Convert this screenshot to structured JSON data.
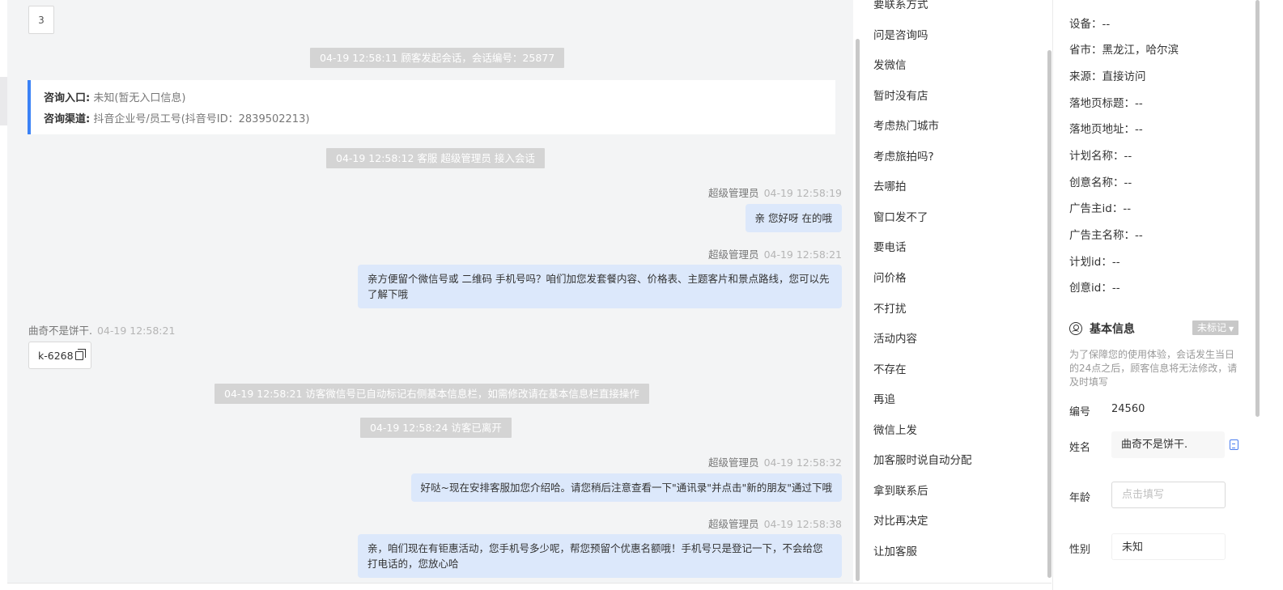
{
  "chat": {
    "page_number": "3",
    "system_messages": [
      "04-19 12:58:11 顾客发起会话，会话编号：25877",
      "04-19 12:58:12 客服 超级管理员 接入会话",
      "04-19 12:58:21 访客微信号已自动标记右侧基本信息栏，如需修改请在基本信息栏直接操作",
      "04-19 12:58:24 访客已离开"
    ],
    "info_card": {
      "entry_label": "咨询入口:",
      "entry_value": "未知(暂无入口信息)",
      "channel_label": "咨询渠道:",
      "channel_value": "抖音企业号/员工号(抖音号ID：2839502213)"
    },
    "messages": [
      {
        "sender": "超级管理员",
        "time": "04-19 12:58:19",
        "text": "亲 您好呀 在的哦"
      },
      {
        "sender": "超级管理员",
        "time": "04-19 12:58:21",
        "text": "亲方便留个微信号或 二维码 手机号吗？咱们加您发套餐内容、价格表、主题客片和景点路线，您可以先了解下哦"
      },
      {
        "sender": "曲奇不是饼干.",
        "time": "04-19 12:58:21",
        "text": "k-6268"
      },
      {
        "sender": "超级管理员",
        "time": "04-19 12:58:32",
        "text": "好哒~现在安排客服加您介绍哈。请您稍后注意查看一下\"通讯录\"并点击\"新的朋友\"通过下哦"
      },
      {
        "sender": "超级管理员",
        "time": "04-19 12:58:38",
        "text": "亲，咱们现在有钜惠活动，您手机号多少呢，帮您预留个优惠名额哦！手机号只是登记一下，不会给您打电话的，您放心哈"
      }
    ]
  },
  "quick_replies": [
    "要联系方式",
    "问是咨询吗",
    "发微信",
    "暂时没有店",
    "考虑热门城市",
    "考虑旅拍吗?",
    "去哪拍",
    "窗口发不了",
    "要电话",
    "问价格",
    "不打扰",
    "活动内容",
    "不存在",
    "再追",
    "微信上发",
    "加客服时说自动分配",
    "拿到联系后",
    "对比再决定",
    "让加客服"
  ],
  "visitor_info": [
    "设备：--",
    "省市：黑龙江，哈尔滨",
    "来源：直接访问",
    "落地页标题：--",
    "落地页地址：--",
    "计划名称：--",
    "创意名称：--",
    "广告主id：--",
    "广告主名称：--",
    "计划id：--",
    "创意id：--"
  ],
  "basic_info": {
    "title": "基本信息",
    "tag": "未标记",
    "notice": "为了保障您的使用体验，会话发生当日的24点之后，顾客信息将无法修改，请及时填写",
    "id_label": "编号",
    "id_value": "24560",
    "name_label": "姓名",
    "name_value": "曲奇不是饼干.",
    "age_label": "年龄",
    "age_placeholder": "点击填写",
    "gender_label": "性别",
    "gender_value": "未知"
  },
  "colors": {
    "accent": "#3b82f6",
    "bubble": "#dce8fb",
    "chat_bg": "#f3f4f5",
    "system_bar": "#d4d4d4"
  }
}
